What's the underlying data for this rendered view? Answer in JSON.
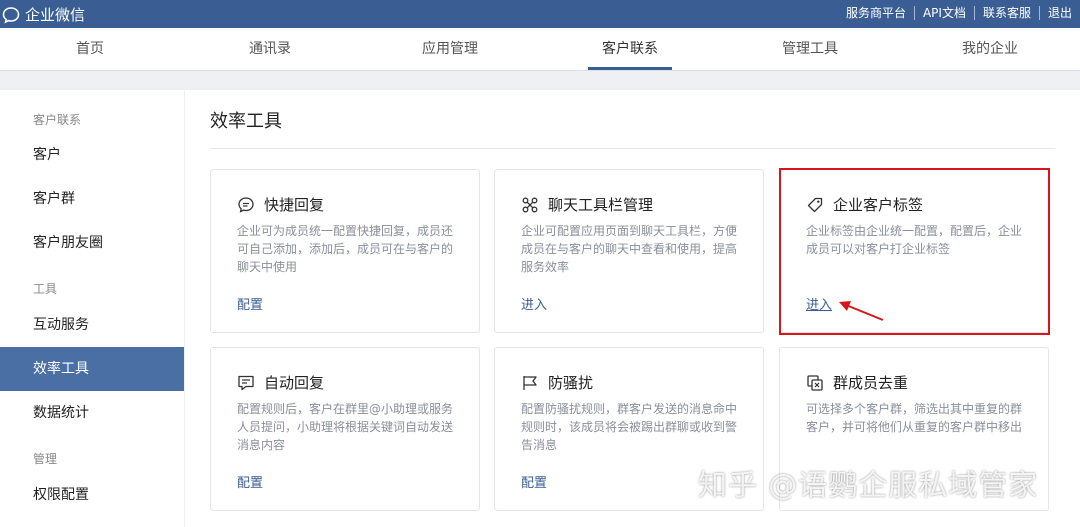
{
  "app": {
    "title": "企业微信"
  },
  "top_links": [
    "服务商平台",
    "API文档",
    "联系客服",
    "退出"
  ],
  "nav": {
    "tabs": [
      "首页",
      "通讯录",
      "应用管理",
      "客户联系",
      "管理工具",
      "我的企业"
    ],
    "active": "客户联系"
  },
  "sidebar": {
    "groups": [
      "客户联系",
      "工具",
      "管理"
    ],
    "items": [
      "客户",
      "客户群",
      "客户朋友圈",
      "互动服务",
      "效率工具",
      "数据统计",
      "权限配置"
    ],
    "active": "效率工具"
  },
  "main": {
    "title": "效率工具",
    "cards": [
      {
        "title": "快捷回复",
        "icon": "chat-bubble-icon",
        "desc": "企业可为成员统一配置快捷回复，成员还可自己添加，添加后，成员可在与客户的聊天中使用",
        "link": "配置"
      },
      {
        "title": "聊天工具栏管理",
        "icon": "toolbar-icon",
        "desc": "企业可配置应用页面到聊天工具栏，方便成员在与客户的聊天中查看和使用，提高服务效率",
        "link": "进入"
      },
      {
        "title": "企业客户标签",
        "icon": "tag-icon",
        "desc": "企业标签由企业统一配置，配置后，企业成员可以对客户打企业标签",
        "link": "进入"
      },
      {
        "title": "自动回复",
        "icon": "auto-reply-icon",
        "desc": "配置规则后，客户在群里@小助理或服务人员提问，小助理将根据关键词自动发送消息内容",
        "link": "配置"
      },
      {
        "title": "防骚扰",
        "icon": "flag-icon",
        "desc": "配置防骚扰规则，群客户发送的消息命中规则时，该成员将会被踢出群聊或收到警告消息",
        "link": "配置"
      },
      {
        "title": "群成员去重",
        "icon": "dedupe-icon",
        "desc": "可选择多个客户群，筛选出其中重复的群客户，并可将他们从重复的客户群中移出",
        "link": ""
      }
    ]
  },
  "watermark": "知乎 @语鹦企服私域管家",
  "colors": {
    "brand": "#3a5e93",
    "active_sidebar": "#4a6fa5",
    "highlight": "#d9141b"
  }
}
